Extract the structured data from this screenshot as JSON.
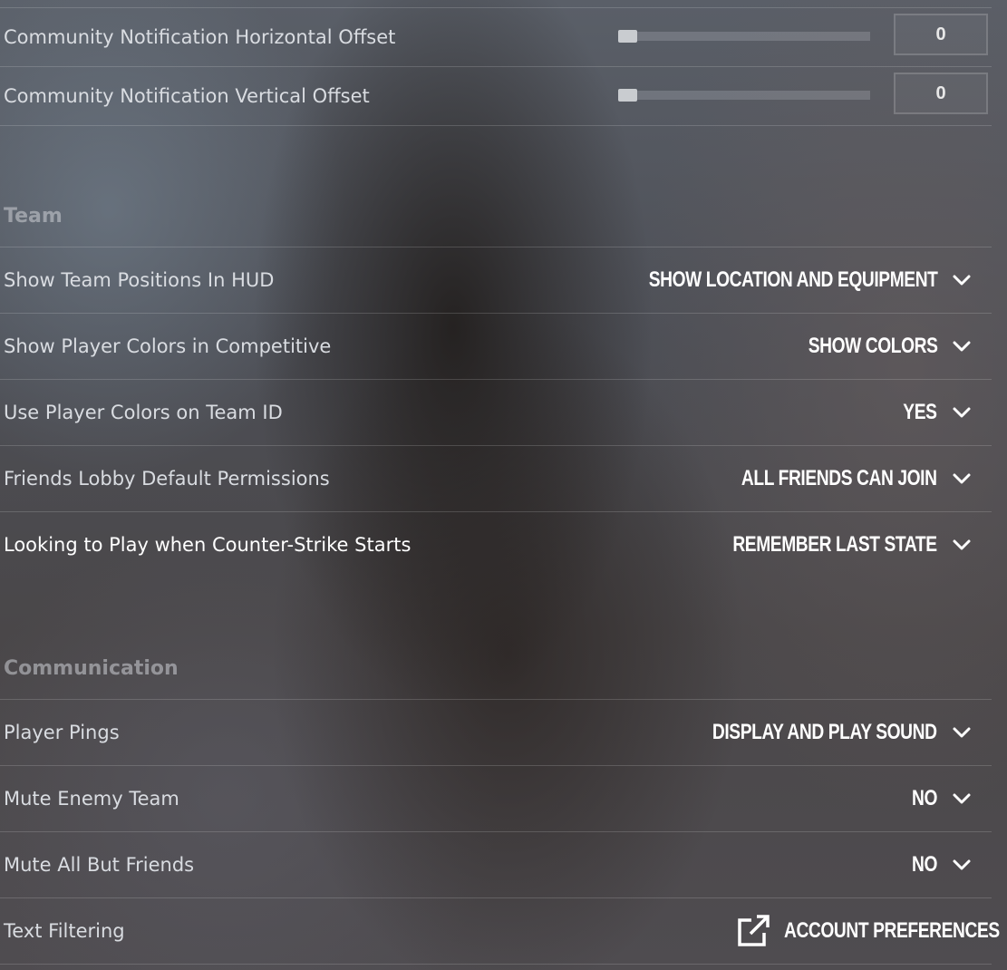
{
  "offsets": [
    {
      "label": "Community Notification Horizontal Offset",
      "value": "0",
      "slider_fraction": 0
    },
    {
      "label": "Community Notification Vertical Offset",
      "value": "0",
      "slider_fraction": 0
    }
  ],
  "team": {
    "header": "Team",
    "rows": [
      {
        "label": "Show Team Positions In HUD",
        "value": "SHOW LOCATION AND EQUIPMENT"
      },
      {
        "label": "Show Player Colors in Competitive",
        "value": "SHOW COLORS"
      },
      {
        "label": "Use Player Colors on Team ID",
        "value": "YES"
      },
      {
        "label": "Friends Lobby Default Permissions",
        "value": "ALL FRIENDS CAN JOIN"
      },
      {
        "label": "Looking to Play when Counter-Strike Starts",
        "value": "REMEMBER LAST STATE"
      }
    ]
  },
  "communication": {
    "header": "Communication",
    "rows": [
      {
        "label": "Player Pings",
        "value": "DISPLAY AND PLAY SOUND"
      },
      {
        "label": "Mute Enemy Team",
        "value": "NO"
      },
      {
        "label": "Mute All But Friends",
        "value": "NO"
      }
    ],
    "text_filtering": {
      "label": "Text Filtering",
      "link_label": "ACCOUNT PREFERENCES",
      "icon": "external-link-icon"
    }
  },
  "icons": {
    "dropdown": "chevron-down-icon"
  }
}
